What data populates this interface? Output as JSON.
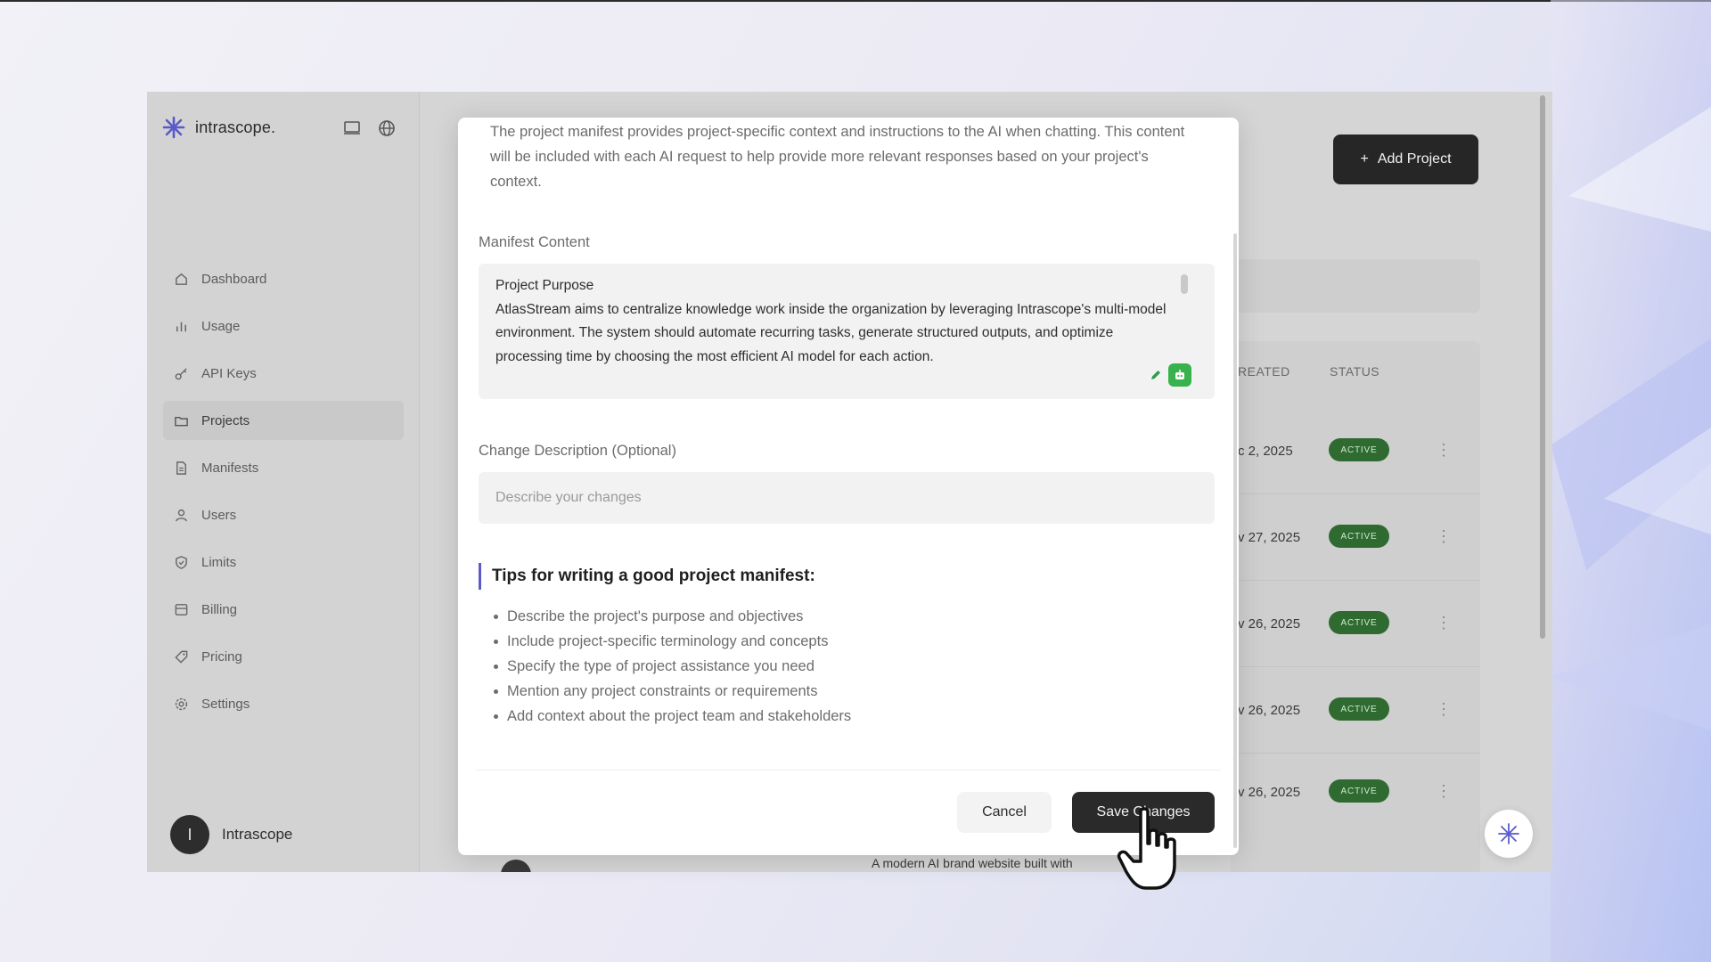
{
  "app": {
    "brand_name": "intrascope.",
    "accent_color": "#5a5acb"
  },
  "sidebar": {
    "items": [
      {
        "label": "Dashboard",
        "icon": "home-icon"
      },
      {
        "label": "Usage",
        "icon": "bar-chart-icon"
      },
      {
        "label": "API Keys",
        "icon": "key-icon"
      },
      {
        "label": "Projects",
        "icon": "folder-icon",
        "active": true
      },
      {
        "label": "Manifests",
        "icon": "document-icon"
      },
      {
        "label": "Users",
        "icon": "user-icon"
      },
      {
        "label": "Limits",
        "icon": "shield-icon"
      },
      {
        "label": "Billing",
        "icon": "billing-icon"
      },
      {
        "label": "Pricing",
        "icon": "tag-icon"
      },
      {
        "label": "Settings",
        "icon": "gear-icon"
      }
    ],
    "user": {
      "initial": "I",
      "name": "Intrascope"
    }
  },
  "main": {
    "add_project_label": "Add Project",
    "table": {
      "headers": {
        "created": "REATED",
        "status": "STATUS"
      },
      "rows": [
        {
          "date": "c 2, 2025",
          "status": "ACTIVE"
        },
        {
          "date": "v 27, 2025",
          "status": "ACTIVE"
        },
        {
          "date": "v 26, 2025",
          "status": "ACTIVE"
        },
        {
          "date": "v 26, 2025",
          "status": "ACTIVE"
        },
        {
          "date": "v 26, 2025",
          "status": "ACTIVE"
        }
      ],
      "peek_description": "A modern AI brand website built with"
    }
  },
  "modal": {
    "intro": "The project manifest provides project-specific context and instructions to the AI when chatting. This content will be included with each AI request to help provide more relevant responses based on your project's context.",
    "manifest_label": "Manifest Content",
    "manifest_heading": "Project Purpose",
    "manifest_body": "AtlasStream aims to centralize knowledge work inside the organization by leveraging Intrascope's multi-model environment. The system should automate recurring tasks, generate structured outputs, and optimize processing time by choosing the most efficient AI model for each action.",
    "change_label": "Change Description (Optional)",
    "change_placeholder": "Describe your changes",
    "tips_title": "Tips for writing a good project manifest:",
    "tips": [
      "Describe the project's purpose and objectives",
      "Include project-specific terminology and concepts",
      "Specify the type of project assistance you need",
      "Mention any project constraints or requirements",
      "Add context about the project team and stakeholders"
    ],
    "cancel_label": "Cancel",
    "save_label": "Save Changes"
  },
  "colors": {
    "status_active_bg": "#2f6a30",
    "primary_button": "#2a2a2a",
    "assistant_green": "#37b24d"
  }
}
